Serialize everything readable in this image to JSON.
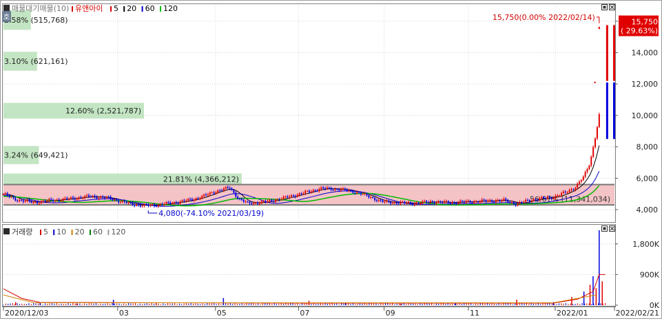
{
  "price_panel": {
    "legend_title": "매물대기매물(10)",
    "legend_items": [
      {
        "label": "유앤아이",
        "color": "#d40000"
      },
      {
        "label": "5",
        "color": "#d40000"
      },
      {
        "label": "20",
        "color": "#000000"
      },
      {
        "label": "60",
        "color": "#0000cc"
      },
      {
        "label": "120",
        "color": "#00bb00"
      }
    ],
    "side_tab": "호"
  },
  "volume_panel": {
    "legend_title": "거래량",
    "legend_items": [
      {
        "label": "5",
        "color": "#d40000"
      },
      {
        "label": "10",
        "color": "#0000cc"
      },
      {
        "label": "20",
        "color": "#d08000"
      },
      {
        "label": "60",
        "color": "#008000"
      },
      {
        "label": "120",
        "color": "#999999"
      }
    ]
  },
  "colors": {
    "up": "#e00000",
    "down": "#0000dd",
    "band_green": "#b9e0b9",
    "band_red": "#f2b8bc"
  },
  "chart_data": [
    {
      "type": "candlestick",
      "name": "price",
      "y_ticks": [
        "4,000",
        "6,000",
        "8,000",
        "10,000",
        "12,000",
        "14,000",
        "16,000"
      ],
      "y_tick_values": [
        4000,
        6000,
        8000,
        10000,
        12000,
        14000,
        16000
      ],
      "ylim": [
        3300,
        17000
      ],
      "x_ticks": [
        {
          "label": "2020/12/03",
          "pos": 0.0
        },
        {
          "label": "03",
          "pos": 0.187
        },
        {
          "label": "05",
          "pos": 0.347
        },
        {
          "label": "07",
          "pos": 0.483
        },
        {
          "label": "09",
          "pos": 0.623
        },
        {
          "label": "11",
          "pos": 0.761
        },
        {
          "label": "2022/01",
          "pos": 0.903
        },
        {
          "label": "2022/02/21",
          "pos": 1.0
        }
      ],
      "close_series": [
        [
          0.0,
          5000
        ],
        [
          0.02,
          4650
        ],
        [
          0.05,
          4450
        ],
        [
          0.08,
          4600
        ],
        [
          0.11,
          4700
        ],
        [
          0.14,
          4850
        ],
        [
          0.17,
          4750
        ],
        [
          0.19,
          4550
        ],
        [
          0.21,
          4350
        ],
        [
          0.23,
          4250
        ],
        [
          0.25,
          4300
        ],
        [
          0.28,
          4450
        ],
        [
          0.31,
          4650
        ],
        [
          0.33,
          4900
        ],
        [
          0.35,
          5200
        ],
        [
          0.37,
          5400
        ],
        [
          0.385,
          4700
        ],
        [
          0.4,
          4400
        ],
        [
          0.43,
          4500
        ],
        [
          0.46,
          4750
        ],
        [
          0.49,
          5050
        ],
        [
          0.52,
          5350
        ],
        [
          0.55,
          5300
        ],
        [
          0.58,
          5100
        ],
        [
          0.6,
          4800
        ],
        [
          0.62,
          4500
        ],
        [
          0.64,
          4450
        ],
        [
          0.67,
          4400
        ],
        [
          0.7,
          4500
        ],
        [
          0.73,
          4450
        ],
        [
          0.76,
          4500
        ],
        [
          0.79,
          4550
        ],
        [
          0.82,
          4600
        ],
        [
          0.84,
          4350
        ],
        [
          0.86,
          4600
        ],
        [
          0.88,
          4700
        ],
        [
          0.9,
          4800
        ],
        [
          0.92,
          5100
        ],
        [
          0.935,
          5400
        ],
        [
          0.95,
          6100
        ],
        [
          0.96,
          7000
        ],
        [
          0.968,
          8500
        ],
        [
          0.975,
          10000
        ]
      ],
      "last_bar": {
        "date": "2022/02/21",
        "open": 8500,
        "high": 16000,
        "low": 8400,
        "close": 15750
      },
      "highlight_bars": [
        {
          "pos": 0.988,
          "open": 12200,
          "close": 15750,
          "color": "#e00000"
        },
        {
          "pos": 0.988,
          "open": 8500,
          "close": 12100,
          "color": "#0000dd"
        }
      ],
      "price_bands": [
        {
          "label": "2.58% (515,768)",
          "low": 15450,
          "high": 16700,
          "width": 0.045,
          "color": "#b9e0b9"
        },
        {
          "label": "3.10% (621,161)",
          "low": 12850,
          "high": 14050,
          "width": 0.055,
          "color": "#b9e0b9"
        },
        {
          "label": "12.60% (2,521,787)",
          "low": 9800,
          "high": 10800,
          "width": 0.23,
          "color": "#b9e0b9"
        },
        {
          "label": "3.24% (649,421)",
          "low": 6900,
          "high": 8050,
          "width": 0.058,
          "color": "#b9e0b9"
        },
        {
          "label": "21.81% (4,366,212)",
          "low": 5600,
          "high": 6300,
          "width": 0.39,
          "color": "#b9e0b9"
        },
        {
          "label": "56.67% (11,341,034)",
          "low": 4300,
          "high": 5600,
          "width": 1.0,
          "color": "#f2b8bc"
        }
      ],
      "band_lines": [
        5600,
        4300
      ],
      "annotations": [
        {
          "text": "15,750(0.00% 2022/02/14)",
          "value": 16000,
          "pos": 0.975,
          "color": "#d40000",
          "anchor": "end"
        },
        {
          "text": "4,080(-74.10% 2021/03/19)",
          "value": 4080,
          "pos": 0.237,
          "color": "#0000cc",
          "anchor": "start"
        }
      ],
      "last_price_label": "15,750",
      "last_change_label": "( 29.63%)"
    },
    {
      "type": "bar",
      "name": "volume",
      "y_ticks": [
        "0K",
        "900K",
        "1,800K"
      ],
      "y_tick_values": [
        0,
        900000,
        1800000
      ],
      "ylim": [
        0,
        2300000
      ],
      "bars": [
        [
          0.02,
          90000
        ],
        [
          0.06,
          60000
        ],
        [
          0.12,
          50000
        ],
        [
          0.18,
          160000
        ],
        [
          0.25,
          60000
        ],
        [
          0.36,
          210000
        ],
        [
          0.5,
          130000
        ],
        [
          0.56,
          60000
        ],
        [
          0.65,
          40000
        ],
        [
          0.74,
          70000
        ],
        [
          0.84,
          160000
        ],
        [
          0.9,
          90000
        ],
        [
          0.93,
          240000
        ],
        [
          0.95,
          400000
        ],
        [
          0.96,
          600000
        ],
        [
          0.965,
          850000
        ],
        [
          0.97,
          500000
        ],
        [
          0.975,
          2200000
        ],
        [
          0.98,
          700000
        ]
      ],
      "ma5": [
        [
          0.0,
          480000
        ],
        [
          0.03,
          200000
        ],
        [
          0.06,
          80000
        ],
        [
          0.5,
          60000
        ],
        [
          0.9,
          60000
        ],
        [
          0.94,
          180000
        ],
        [
          0.965,
          400000
        ],
        [
          0.975,
          900000
        ],
        [
          0.985,
          900000
        ]
      ]
    }
  ]
}
